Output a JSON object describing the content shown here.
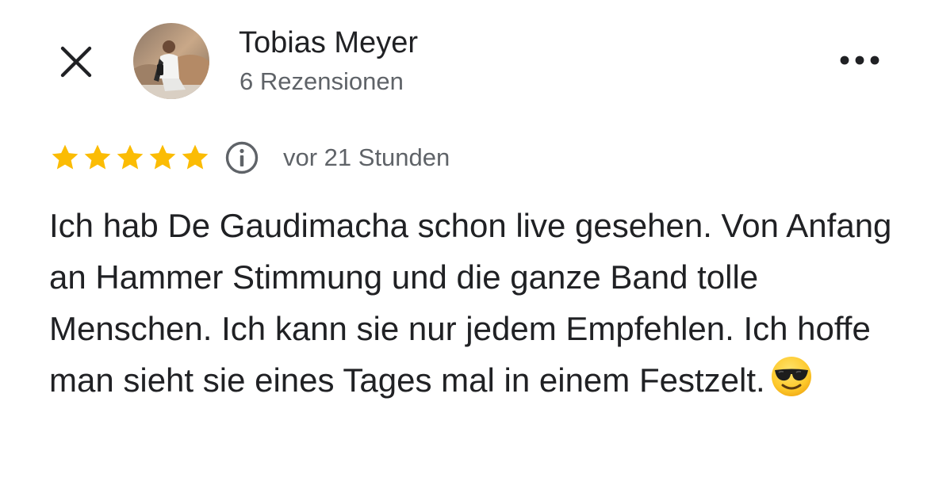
{
  "reviewer": {
    "name": "Tobias Meyer",
    "reviews_count": "6 Rezensionen"
  },
  "review": {
    "rating": 5,
    "rating_max": 5,
    "time": "vor 21 Stunden",
    "text": "Ich hab De Gaudimacha schon live gesehen. Von Anfang an Hammer Stimmung und die ganze Band tolle Menschen. Ich kann sie nur jedem Empfehlen. Ich hoffe man sieht sie eines Tages mal in einem Festzelt.",
    "emoji": "smiling-face-with-sunglasses"
  },
  "icons": {
    "close": "close-icon",
    "more": "more-horizontal-icon",
    "info": "info-icon",
    "star": "star-icon"
  },
  "colors": {
    "star": "#fbbc04",
    "text_primary": "#202124",
    "text_secondary": "#5f6368",
    "icon_dark": "#202124",
    "info_icon": "#5f6368"
  }
}
